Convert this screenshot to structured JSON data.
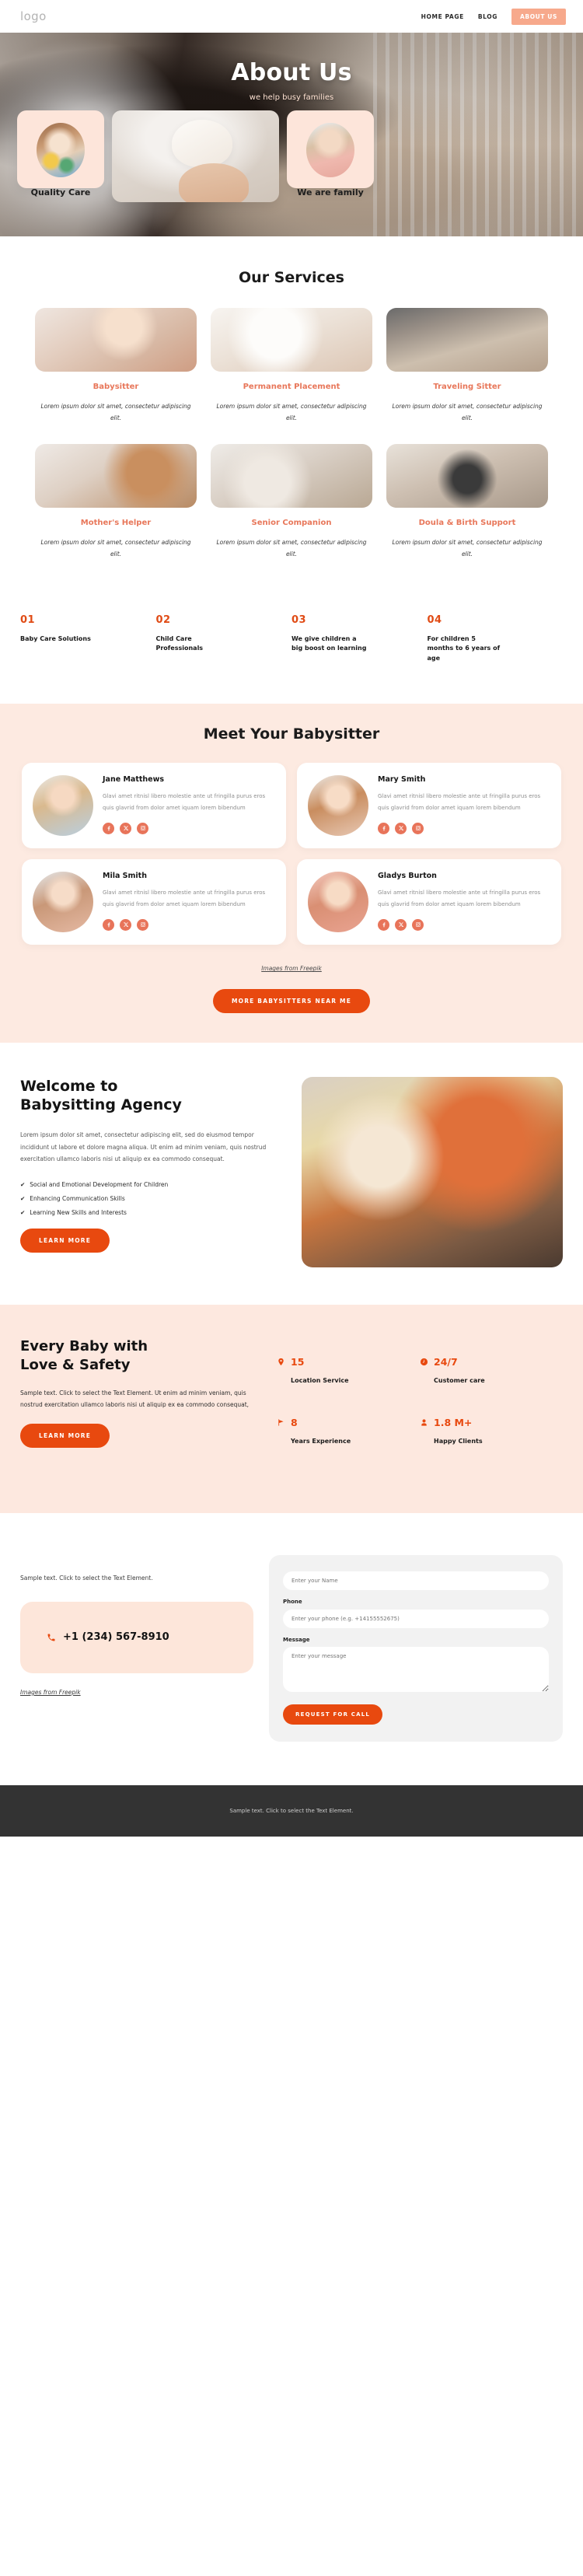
{
  "header": {
    "logo": "logo",
    "nav": [
      {
        "label": "HOME PAGE",
        "active": false
      },
      {
        "label": "BLOG",
        "active": false
      },
      {
        "label": "ABOUT US",
        "active": true
      }
    ]
  },
  "hero": {
    "title": "About Us",
    "subtitle": "we help busy families",
    "cards": [
      {
        "title": "Quality Care"
      },
      {
        "title": ""
      },
      {
        "title": "We are family"
      }
    ]
  },
  "services": {
    "title": "Our Services",
    "items": [
      {
        "name": "Babysitter",
        "desc": "Lorem ipsum dolor sit amet, consectetur adipiscing elit."
      },
      {
        "name": "Permanent Placement",
        "desc": "Lorem ipsum dolor sit amet, consectetur adipiscing elit."
      },
      {
        "name": "Traveling Sitter",
        "desc": "Lorem ipsum dolor sit amet, consectetur adipiscing elit."
      },
      {
        "name": "Mother's Helper",
        "desc": "Lorem ipsum dolor sit amet, consectetur adipiscing elit."
      },
      {
        "name": "Senior Companion",
        "desc": "Lorem ipsum dolor sit amet, consectetur adipiscing elit."
      },
      {
        "name": "Doula & Birth Support",
        "desc": "Lorem ipsum dolor sit amet, consectetur adipiscing elit."
      }
    ]
  },
  "numbers": [
    {
      "num": "01",
      "text": "Baby Care Solutions"
    },
    {
      "num": "02",
      "text": "Child Care Professionals"
    },
    {
      "num": "03",
      "text": "We give children a big boost on learning"
    },
    {
      "num": "04",
      "text": "For children 5 months to 6 years of age"
    }
  ],
  "meet": {
    "title": "Meet Your Babysitter",
    "sitters": [
      {
        "name": "Jane Matthews",
        "text": "Glavi amet ritnisl libero molestie ante ut fringilla purus eros quis glavrid from dolor amet iquam lorem bibendum"
      },
      {
        "name": "Mary Smith",
        "text": "Glavi amet ritnisl libero molestie ante ut fringilla purus eros quis glavrid from dolor amet iquam lorem bibendum"
      },
      {
        "name": "Mila Smith",
        "text": "Glavi amet ritnisl libero molestie ante ut fringilla purus eros quis glavrid from dolor amet iquam lorem bibendum"
      },
      {
        "name": "Gladys Burton",
        "text": "Glavi amet ritnisl libero molestie ante ut fringilla purus eros quis glavrid from dolor amet iquam lorem bibendum"
      }
    ],
    "credit": "Images from Freepik",
    "button": "MORE BABYSITTERS NEAR ME"
  },
  "welcome": {
    "title_line1": "Welcome to",
    "title_line2": "Babysitting Agency",
    "text": "Lorem ipsum dolor sit amet, consectetur adipiscing elit, sed do eiusmod tempor incididunt ut labore et dolore magna aliqua. Ut enim ad minim veniam, quis nostrud exercitation ullamco laboris nisi ut aliquip ex ea commodo consequat.",
    "checks": [
      "Social and Emotional Development for Children",
      "Enhancing Communication Skills",
      "Learning New Skills and Interests"
    ],
    "check_mark": "✔",
    "button": "LEARN MORE"
  },
  "stats": {
    "title_line1": "Every Baby with",
    "title_line2": "Love & Safety",
    "text": "Sample text. Click to select the Text Element. Ut enim ad minim veniam, quis nostrud exercitation ullamco laboris nisi ut aliquip ex ea commodo consequat,",
    "button": "LEARN MORE",
    "items": [
      {
        "value": "15",
        "label": "Location Service",
        "icon": "map-pin-icon"
      },
      {
        "value": "24/7",
        "label": "Customer care",
        "icon": "clock-icon"
      },
      {
        "value": "8",
        "label": "Years Experience",
        "icon": "flag-icon"
      },
      {
        "value": "1.8 M+",
        "label": "Happy Clients",
        "icon": "user-icon"
      }
    ]
  },
  "contact": {
    "note": "Sample text. Click to select the Text Element.",
    "phone": "+1 (234) 567-8910",
    "credit": "Images from Freepik",
    "form": {
      "name_placeholder": "Enter your Name",
      "phone_label": "Phone",
      "phone_placeholder": "Enter your phone (e.g. +14155552675)",
      "message_label": "Message",
      "message_placeholder": "Enter your message",
      "submit": "REQUEST FOR CALL"
    }
  },
  "footer": {
    "text": "Sample text. Click to select the Text Element."
  },
  "colors": {
    "accent": "#e8490f",
    "accent_soft": "#e8775a",
    "peach_bg": "#fde8df",
    "card_peach": "#fde5da",
    "nav_cta": "#f7a98c",
    "footer_bg": "#333333"
  }
}
